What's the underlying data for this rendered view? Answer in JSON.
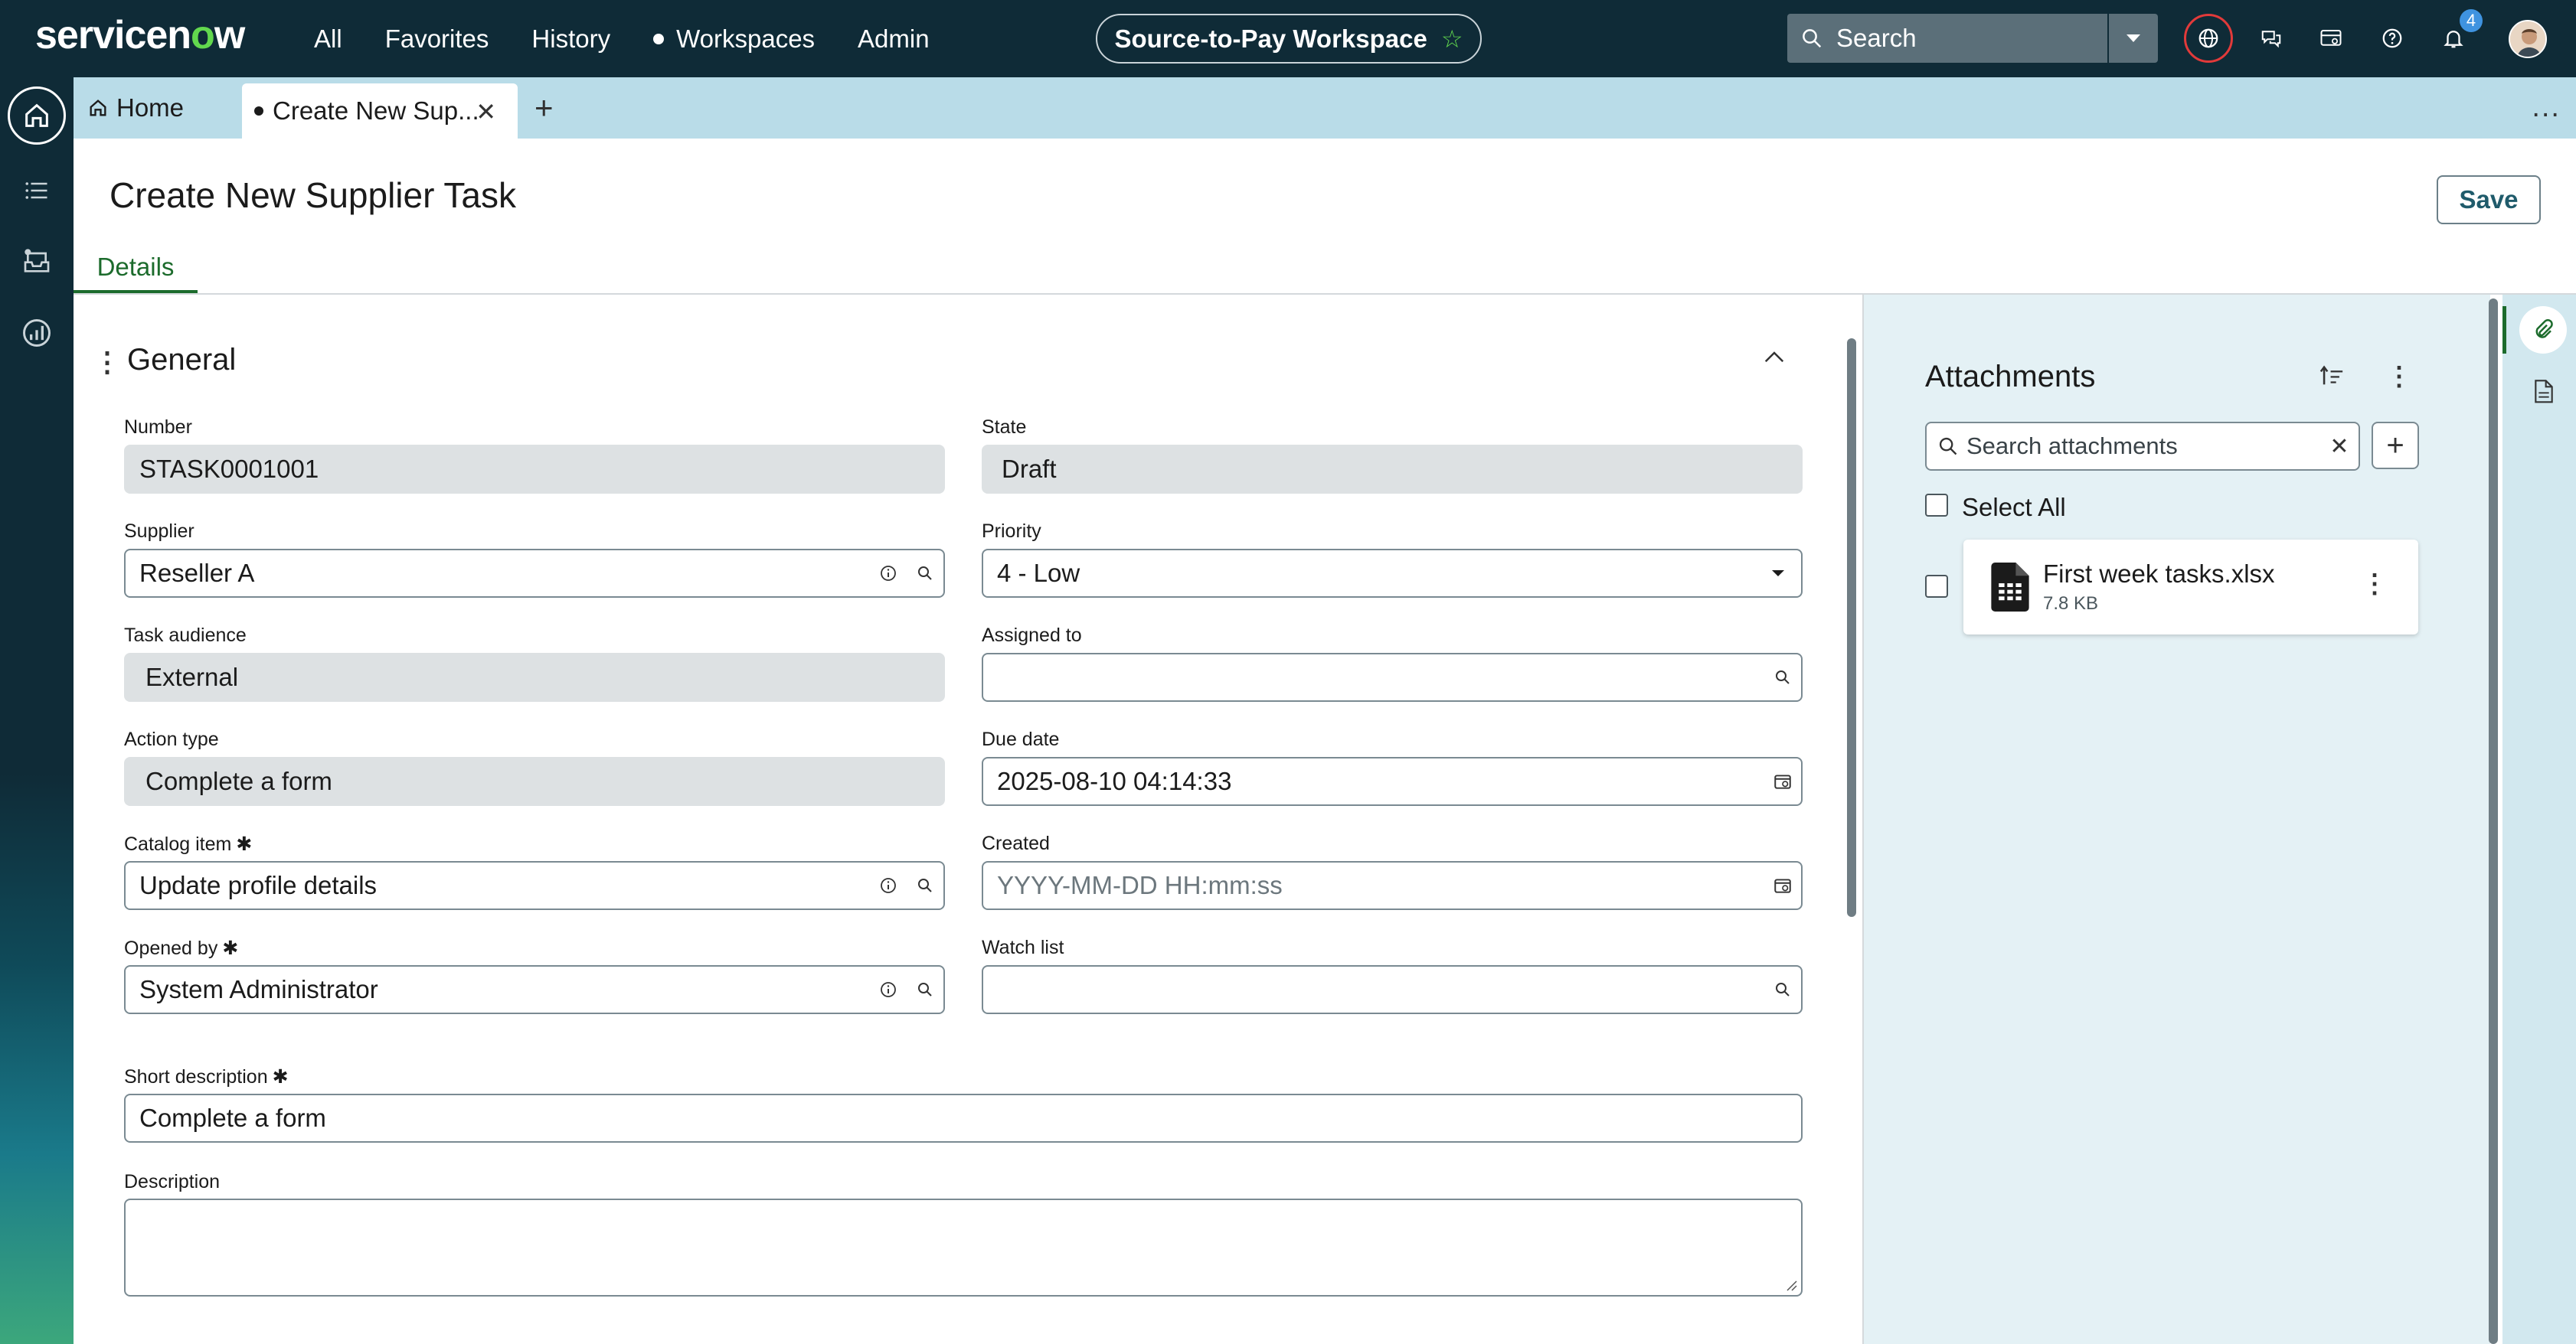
{
  "nav": {
    "logo_prefix": "servicen",
    "logo_o": "o",
    "logo_suffix": "w",
    "menu": [
      "All",
      "Favorites",
      "History",
      "Workspaces",
      "Admin"
    ],
    "workspace": "Source-to-Pay Workspace",
    "search_label": "Search",
    "notification_count": "4"
  },
  "tabs": {
    "home": "Home",
    "active": "Create New Sup...",
    "more": "..."
  },
  "page": {
    "title": "Create New Supplier Task",
    "save": "Save",
    "detail_tab": "Details"
  },
  "section": {
    "title": "General"
  },
  "form": {
    "number": {
      "label": "Number",
      "value": "STASK0001001"
    },
    "state": {
      "label": "State",
      "value": "Draft"
    },
    "supplier": {
      "label": "Supplier",
      "value": "Reseller A"
    },
    "priority": {
      "label": "Priority",
      "value": "4 - Low"
    },
    "task_audience": {
      "label": "Task audience",
      "value": "External"
    },
    "assigned_to": {
      "label": "Assigned to",
      "value": ""
    },
    "action_type": {
      "label": "Action type",
      "value": "Complete a form"
    },
    "due_date": {
      "label": "Due date",
      "value": "2025-08-10 04:14:33"
    },
    "catalog_item": {
      "label": "Catalog item",
      "value": "Update profile details"
    },
    "created": {
      "label": "Created",
      "placeholder": "YYYY-MM-DD HH:mm:ss"
    },
    "opened_by": {
      "label": "Opened by",
      "value": "System Administrator"
    },
    "watch_list": {
      "label": "Watch list",
      "value": ""
    },
    "short_description": {
      "label": "Short description",
      "value": "Complete a form"
    },
    "description": {
      "label": "Description",
      "value": ""
    },
    "required_mark": "✱"
  },
  "attachments": {
    "title": "Attachments",
    "search_placeholder": "Search attachments",
    "select_all": "Select All",
    "files": [
      {
        "name": "First week tasks.xlsx",
        "size": "7.8 KB"
      }
    ]
  },
  "colors": {
    "nav_bg": "#0f2b37",
    "brand_green": "#62d84e",
    "tab_bar": "#b9dce8",
    "active_green": "#1c6b2c",
    "panel_bg": "#e4f1f5"
  },
  "icons": [
    "search-icon",
    "chevron-down-icon",
    "globe-icon",
    "chat-icon",
    "card-icon",
    "help-icon",
    "bell-icon",
    "home-icon",
    "list-icon",
    "inbox-icon",
    "analytics-icon",
    "info-icon",
    "calendar-icon",
    "paperclip-icon",
    "document-icon",
    "sort-icon",
    "kebab-icon",
    "spreadsheet-icon"
  ]
}
